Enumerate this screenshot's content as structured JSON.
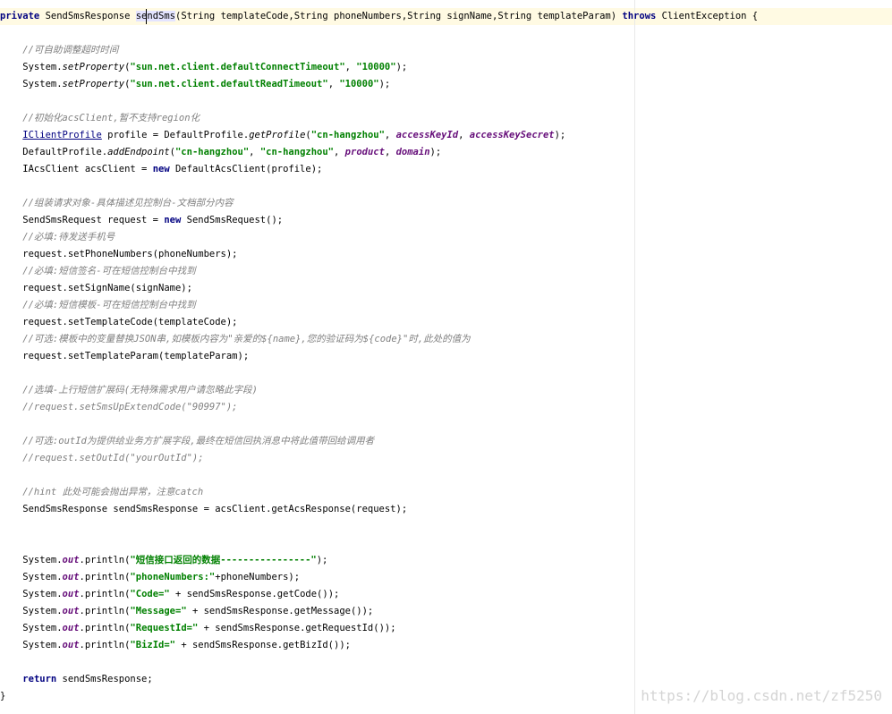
{
  "editor": {
    "caret_after_token": "SendSmsResponse",
    "lines": [
      {
        "tokens": [
          {
            "text": "private",
            "style": "kw"
          },
          {
            "text": " SendSmsResponse "
          },
          {
            "text": "sendSms",
            "style": "hl"
          },
          {
            "text": "(String templateCode,String phoneNumbers,String signName,String templateParam) "
          },
          {
            "text": "throws",
            "style": "kw"
          },
          {
            "text": " ClientException {"
          }
        ]
      },
      {
        "tokens": []
      },
      {
        "tokens": [
          {
            "text": "    //可自助调整超时时间",
            "style": "cmt"
          }
        ]
      },
      {
        "tokens": [
          {
            "text": "    System."
          },
          {
            "text": "setProperty",
            "style": "ital"
          },
          {
            "text": "("
          },
          {
            "text": "\"sun.net.client.defaultConnectTimeout\"",
            "style": "str"
          },
          {
            "text": ", "
          },
          {
            "text": "\"10000\"",
            "style": "str"
          },
          {
            "text": ");"
          }
        ]
      },
      {
        "tokens": [
          {
            "text": "    System."
          },
          {
            "text": "setProperty",
            "style": "ital"
          },
          {
            "text": "("
          },
          {
            "text": "\"sun.net.client.defaultReadTimeout\"",
            "style": "str"
          },
          {
            "text": ", "
          },
          {
            "text": "\"10000\"",
            "style": "str"
          },
          {
            "text": ");"
          }
        ]
      },
      {
        "tokens": []
      },
      {
        "tokens": [
          {
            "text": "    //初始化acsClient,暂不支持region化",
            "style": "cmt"
          }
        ]
      },
      {
        "tokens": [
          {
            "text": "    "
          },
          {
            "text": "IClientProfile",
            "style": "link"
          },
          {
            "text": " profile = DefaultProfile."
          },
          {
            "text": "getProfile",
            "style": "ital"
          },
          {
            "text": "("
          },
          {
            "text": "\"cn-hangzhou\"",
            "style": "str"
          },
          {
            "text": ", "
          },
          {
            "text": "accessKeyId",
            "style": "fld"
          },
          {
            "text": ", "
          },
          {
            "text": "accessKeySecret",
            "style": "fld"
          },
          {
            "text": ");"
          }
        ]
      },
      {
        "tokens": [
          {
            "text": "    DefaultProfile."
          },
          {
            "text": "addEndpoint",
            "style": "ital"
          },
          {
            "text": "("
          },
          {
            "text": "\"cn-hangzhou\"",
            "style": "str"
          },
          {
            "text": ", "
          },
          {
            "text": "\"cn-hangzhou\"",
            "style": "str"
          },
          {
            "text": ", "
          },
          {
            "text": "product",
            "style": "fld"
          },
          {
            "text": ", "
          },
          {
            "text": "domain",
            "style": "fld"
          },
          {
            "text": ");"
          }
        ]
      },
      {
        "tokens": [
          {
            "text": "    IAcsClient acsClient = "
          },
          {
            "text": "new",
            "style": "kw"
          },
          {
            "text": " DefaultAcsClient(profile);"
          }
        ]
      },
      {
        "tokens": []
      },
      {
        "tokens": [
          {
            "text": "    //组装请求对象-具体描述见控制台-文档部分内容",
            "style": "cmt"
          }
        ]
      },
      {
        "tokens": [
          {
            "text": "    SendSmsRequest request = "
          },
          {
            "text": "new",
            "style": "kw"
          },
          {
            "text": " SendSmsRequest();"
          }
        ]
      },
      {
        "tokens": [
          {
            "text": "    //必填:待发送手机号",
            "style": "cmt"
          }
        ]
      },
      {
        "tokens": [
          {
            "text": "    request.setPhoneNumbers(phoneNumbers);"
          }
        ]
      },
      {
        "tokens": [
          {
            "text": "    //必填:短信签名-可在短信控制台中找到",
            "style": "cmt"
          }
        ]
      },
      {
        "tokens": [
          {
            "text": "    request.setSignName(signName);"
          }
        ]
      },
      {
        "tokens": [
          {
            "text": "    //必填:短信模板-可在短信控制台中找到",
            "style": "cmt"
          }
        ]
      },
      {
        "tokens": [
          {
            "text": "    request.setTemplateCode(templateCode);"
          }
        ]
      },
      {
        "tokens": [
          {
            "text": "    //可选:模板中的变量替换JSON串,如模板内容为\"亲爱的${name},您的验证码为${code}\"时,此处的值为",
            "style": "cmt"
          }
        ]
      },
      {
        "tokens": [
          {
            "text": "    request.setTemplateParam(templateParam);"
          }
        ]
      },
      {
        "tokens": []
      },
      {
        "tokens": [
          {
            "text": "    //选填-上行短信扩展码(无特殊需求用户请忽略此字段)",
            "style": "cmt"
          }
        ]
      },
      {
        "tokens": [
          {
            "text": "    //request.setSmsUpExtendCode(\"90997\");",
            "style": "cmt"
          }
        ]
      },
      {
        "tokens": []
      },
      {
        "tokens": [
          {
            "text": "    //可选:outId为提供给业务方扩展字段,最终在短信回执消息中将此值带回给调用者",
            "style": "cmt"
          }
        ]
      },
      {
        "tokens": [
          {
            "text": "    //request.setOutId(\"yourOutId\");",
            "style": "cmt"
          }
        ]
      },
      {
        "tokens": []
      },
      {
        "tokens": [
          {
            "text": "    //hint 此处可能会抛出异常，注意catch",
            "style": "cmt"
          }
        ]
      },
      {
        "tokens": [
          {
            "text": "    SendSmsResponse sendSmsResponse = acsClient.getAcsResponse(request);"
          }
        ]
      },
      {
        "tokens": []
      },
      {
        "tokens": []
      },
      {
        "tokens": [
          {
            "text": "    System."
          },
          {
            "text": "out",
            "style": "fld"
          },
          {
            "text": ".println("
          },
          {
            "text": "\"短信接口返回的数据----------------\"",
            "style": "str"
          },
          {
            "text": ");"
          }
        ]
      },
      {
        "tokens": [
          {
            "text": "    System."
          },
          {
            "text": "out",
            "style": "fld"
          },
          {
            "text": ".println("
          },
          {
            "text": "\"phoneNumbers:\"",
            "style": "str"
          },
          {
            "text": "+phoneNumbers);"
          }
        ]
      },
      {
        "tokens": [
          {
            "text": "    System."
          },
          {
            "text": "out",
            "style": "fld"
          },
          {
            "text": ".println("
          },
          {
            "text": "\"Code=\"",
            "style": "str"
          },
          {
            "text": " + sendSmsResponse.getCode());"
          }
        ]
      },
      {
        "tokens": [
          {
            "text": "    System."
          },
          {
            "text": "out",
            "style": "fld"
          },
          {
            "text": ".println("
          },
          {
            "text": "\"Message=\"",
            "style": "str"
          },
          {
            "text": " + sendSmsResponse.getMessage());"
          }
        ]
      },
      {
        "tokens": [
          {
            "text": "    System."
          },
          {
            "text": "out",
            "style": "fld"
          },
          {
            "text": ".println("
          },
          {
            "text": "\"RequestId=\"",
            "style": "str"
          },
          {
            "text": " + sendSmsResponse.getRequestId());"
          }
        ]
      },
      {
        "tokens": [
          {
            "text": "    System."
          },
          {
            "text": "out",
            "style": "fld"
          },
          {
            "text": ".println("
          },
          {
            "text": "\"BizId=\"",
            "style": "str"
          },
          {
            "text": " + sendSmsResponse.getBizId());"
          }
        ]
      },
      {
        "tokens": []
      },
      {
        "tokens": [
          {
            "text": "    "
          },
          {
            "text": "return",
            "style": "kw"
          },
          {
            "text": " sendSmsResponse;"
          }
        ]
      },
      {
        "tokens": [
          {
            "text": "}"
          }
        ]
      }
    ]
  },
  "watermark": {
    "text": "https://blog.csdn.net/zf5250"
  }
}
